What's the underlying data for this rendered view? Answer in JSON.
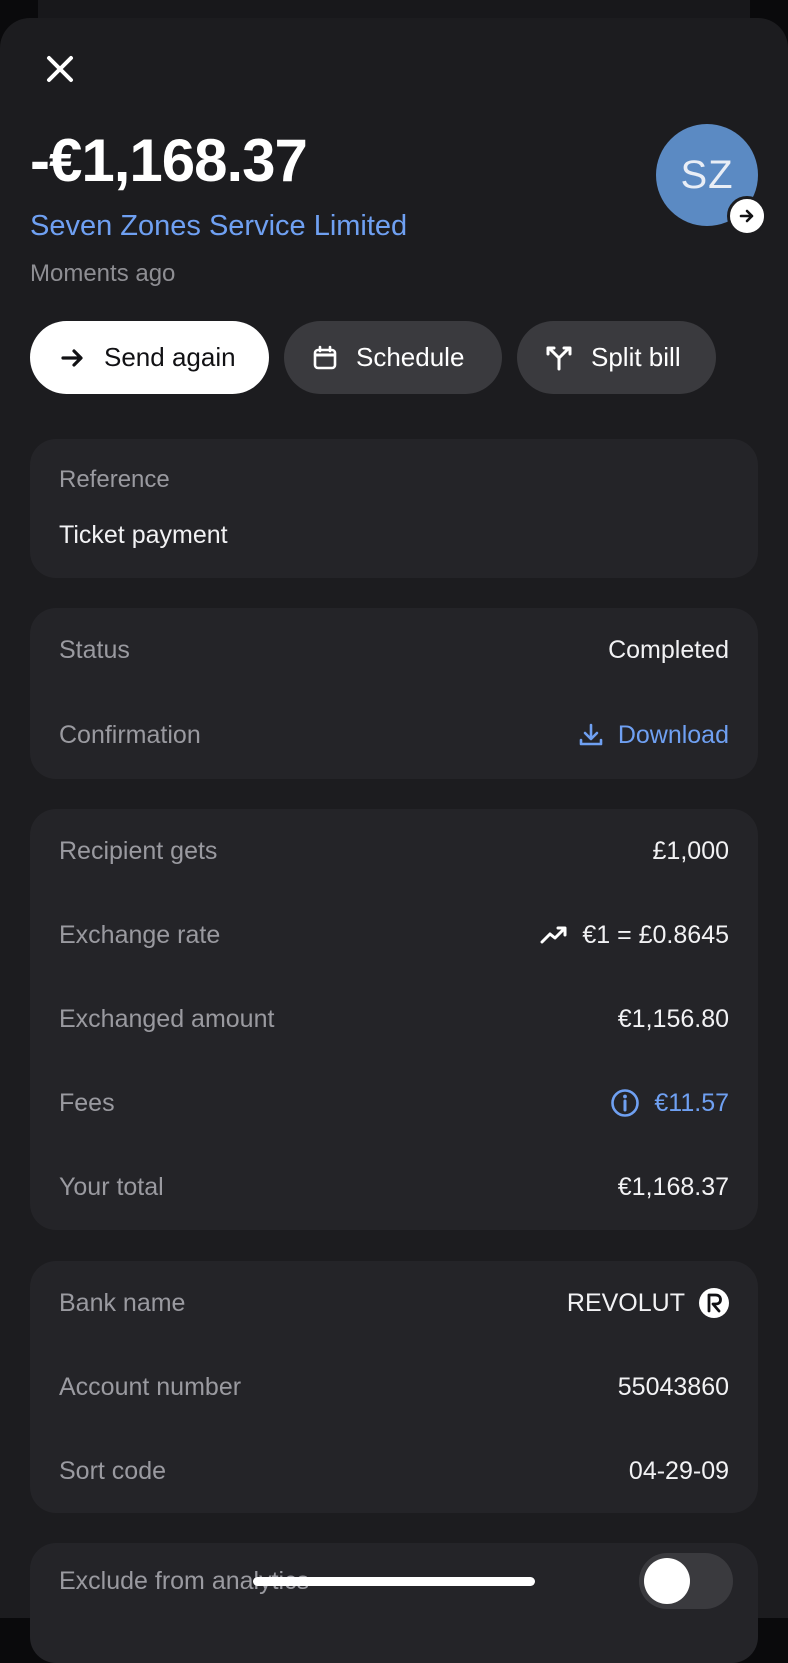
{
  "transaction": {
    "amount": "-€1,168.37",
    "merchant": "Seven Zones Service Limited",
    "time": "Moments ago",
    "avatar_initials": "SZ",
    "avatar_color": "#5b8ac3"
  },
  "actions": {
    "send_again": "Send again",
    "schedule": "Schedule",
    "split_bill": "Split bill"
  },
  "reference": {
    "label": "Reference",
    "value": "Ticket payment"
  },
  "status": {
    "status_label": "Status",
    "status_value": "Completed",
    "confirmation_label": "Confirmation",
    "download_label": "Download"
  },
  "exchange": {
    "recipient_label": "Recipient gets",
    "recipient_value": "£1,000",
    "rate_label": "Exchange rate",
    "rate_value": "€1 = £0.8645",
    "exchanged_label": "Exchanged amount",
    "exchanged_value": "€1,156.80",
    "fees_label": "Fees",
    "fees_value": "€11.57",
    "total_label": "Your total",
    "total_value": "€1,168.37"
  },
  "bank": {
    "bank_label": "Bank name",
    "bank_value": "REVOLUT",
    "account_label": "Account number",
    "account_value": "55043860",
    "sort_label": "Sort code",
    "sort_value": "04-29-09"
  },
  "analytics": {
    "label": "Exclude from analytics",
    "enabled": false
  },
  "colors": {
    "accent": "#6fa0f2",
    "sheet_bg": "#1c1c1f",
    "card_bg": "#242428"
  },
  "icons": {
    "close": "close-icon",
    "arrow": "arrow-right-icon",
    "calendar": "calendar-icon",
    "split": "split-icon",
    "download": "download-icon",
    "trend": "trend-up-icon",
    "info": "info-icon",
    "bank_logo": "revolut-logo-icon"
  }
}
